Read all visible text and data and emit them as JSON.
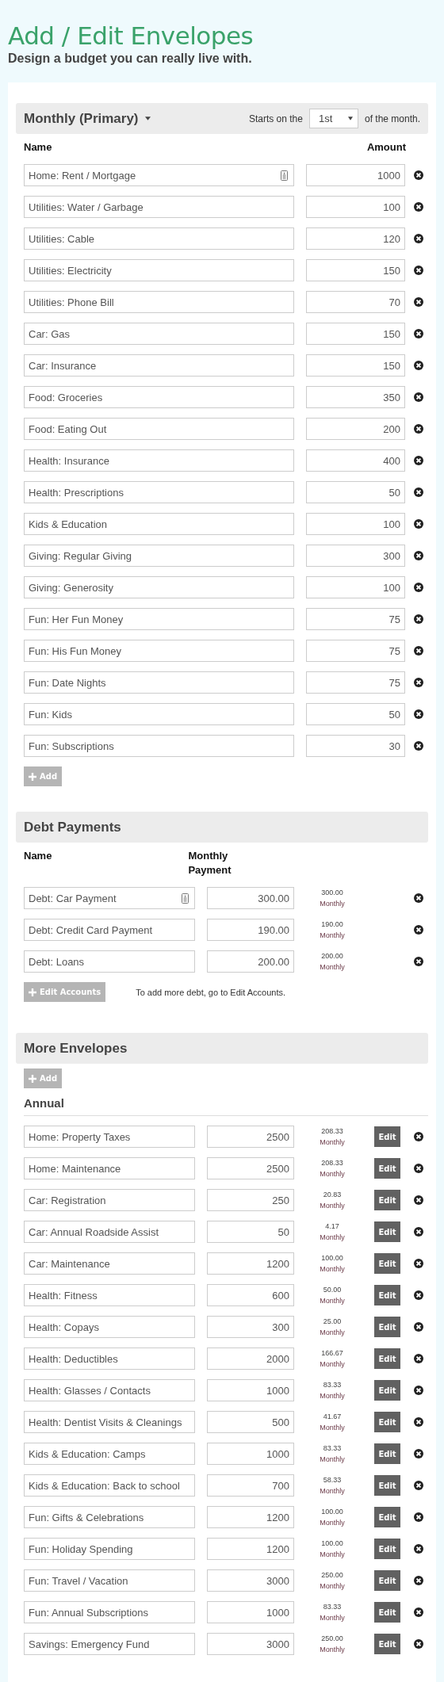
{
  "page": {
    "title": "Add / Edit Envelopes",
    "subtitle": "Design a budget you can really live with."
  },
  "monthly": {
    "title": "Monthly (Primary)",
    "starts_label": "Starts on the",
    "start_day": "1st",
    "month_label": "of the month.",
    "columns": [
      "Name",
      "Amount"
    ],
    "rows": [
      {
        "name": "Home: Rent / Mortgage",
        "amount": "1000",
        "note": true
      },
      {
        "name": "Utilities: Water / Garbage",
        "amount": "100",
        "note": false
      },
      {
        "name": "Utilities: Cable",
        "amount": "120",
        "note": false
      },
      {
        "name": "Utilities: Electricity",
        "amount": "150",
        "note": false
      },
      {
        "name": "Utilities: Phone Bill",
        "amount": "70",
        "note": false
      },
      {
        "name": "Car: Gas",
        "amount": "150",
        "note": false
      },
      {
        "name": "Car: Insurance",
        "amount": "150",
        "note": false
      },
      {
        "name": "Food: Groceries",
        "amount": "350",
        "note": false
      },
      {
        "name": "Food: Eating Out",
        "amount": "200",
        "note": false
      },
      {
        "name": "Health: Insurance",
        "amount": "400",
        "note": false
      },
      {
        "name": "Health: Prescriptions",
        "amount": "50",
        "note": false
      },
      {
        "name": "Kids & Education",
        "amount": "100",
        "note": false
      },
      {
        "name": "Giving: Regular Giving",
        "amount": "300",
        "note": false
      },
      {
        "name": "Giving: Generosity",
        "amount": "100",
        "note": false
      },
      {
        "name": "Fun: Her Fun Money",
        "amount": "75",
        "note": false
      },
      {
        "name": "Fun: His Fun Money",
        "amount": "75",
        "note": false
      },
      {
        "name": "Fun: Date Nights",
        "amount": "75",
        "note": false
      },
      {
        "name": "Fun: Kids",
        "amount": "50",
        "note": false
      },
      {
        "name": "Fun: Subscriptions",
        "amount": "30",
        "note": false
      }
    ],
    "add_button": "Add"
  },
  "debt": {
    "title": "Debt Payments",
    "columns": [
      "Name",
      "Monthly Payment"
    ],
    "rows": [
      {
        "name": "Debt: Car Payment",
        "amount": "300.00",
        "monthly_amount": "300.00",
        "period": "Monthly",
        "note": true
      },
      {
        "name": "Debt: Credit Card Payment",
        "amount": "190.00",
        "monthly_amount": "190.00",
        "period": "Monthly",
        "note": false
      },
      {
        "name": "Debt: Loans",
        "amount": "200.00",
        "monthly_amount": "200.00",
        "period": "Monthly",
        "note": false
      }
    ],
    "button": "Edit Accounts",
    "hint": "To add more debt, go to Edit Accounts."
  },
  "more": {
    "title": "More Envelopes",
    "add_button": "Add",
    "groups": [
      {
        "title": "Annual",
        "rows": [
          {
            "name": "Home: Property Taxes",
            "amount": "2500",
            "monthly_amount": "208.33",
            "period": "Monthly",
            "edit_button": "Edit"
          },
          {
            "name": "Home: Maintenance",
            "amount": "2500",
            "monthly_amount": "208.33",
            "period": "Monthly",
            "edit_button": "Edit"
          },
          {
            "name": "Car: Registration",
            "amount": "250",
            "monthly_amount": "20.83",
            "period": "Monthly",
            "edit_button": "Edit"
          },
          {
            "name": "Car: Annual Roadside Assist",
            "amount": "50",
            "monthly_amount": "4.17",
            "period": "Monthly",
            "edit_button": "Edit"
          },
          {
            "name": "Car: Maintenance",
            "amount": "1200",
            "monthly_amount": "100.00",
            "period": "Monthly",
            "edit_button": "Edit"
          },
          {
            "name": "Health: Fitness",
            "amount": "600",
            "monthly_amount": "50.00",
            "period": "Monthly",
            "edit_button": "Edit"
          },
          {
            "name": "Health: Copays",
            "amount": "300",
            "monthly_amount": "25.00",
            "period": "Monthly",
            "edit_button": "Edit"
          },
          {
            "name": "Health: Deductibles",
            "amount": "2000",
            "monthly_amount": "166.67",
            "period": "Monthly",
            "edit_button": "Edit"
          },
          {
            "name": "Health: Glasses / Contacts",
            "amount": "1000",
            "monthly_amount": "83.33",
            "period": "Monthly",
            "edit_button": "Edit"
          },
          {
            "name": "Health: Dentist Visits & Cleanings",
            "amount": "500",
            "monthly_amount": "41.67",
            "period": "Monthly",
            "edit_button": "Edit"
          },
          {
            "name": "Kids & Education: Camps",
            "amount": "1000",
            "monthly_amount": "83.33",
            "period": "Monthly",
            "edit_button": "Edit"
          },
          {
            "name": "Kids & Education: Back to school",
            "amount": "700",
            "monthly_amount": "58.33",
            "period": "Monthly",
            "edit_button": "Edit"
          },
          {
            "name": "Fun: Gifts & Celebrations",
            "amount": "1200",
            "monthly_amount": "100.00",
            "period": "Monthly",
            "edit_button": "Edit"
          },
          {
            "name": "Fun: Holiday Spending",
            "amount": "1200",
            "monthly_amount": "100.00",
            "period": "Monthly",
            "edit_button": "Edit"
          },
          {
            "name": "Fun: Travel / Vacation",
            "amount": "3000",
            "monthly_amount": "250.00",
            "period": "Monthly",
            "edit_button": "Edit"
          },
          {
            "name": "Fun: Annual Subscriptions",
            "amount": "1000",
            "monthly_amount": "83.33",
            "period": "Monthly",
            "edit_button": "Edit"
          },
          {
            "name": "Savings: Emergency Fund",
            "amount": "3000",
            "monthly_amount": "250.00",
            "period": "Monthly",
            "edit_button": "Edit"
          }
        ]
      }
    ]
  }
}
